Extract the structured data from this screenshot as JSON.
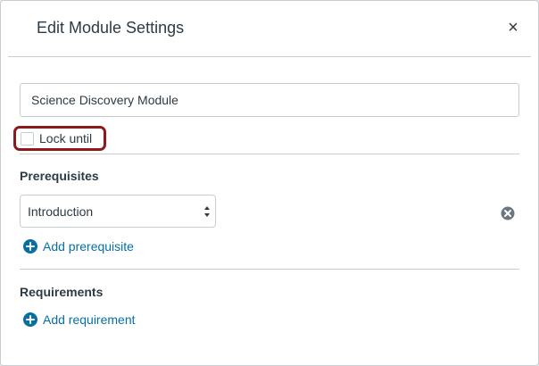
{
  "dialog": {
    "title": "Edit Module Settings",
    "close_symbol": "×"
  },
  "module": {
    "name_value": "Science Discovery Module",
    "lock_until_label": "Lock until",
    "lock_until_checked": false
  },
  "prerequisites": {
    "heading": "Prerequisites",
    "selected": "Introduction",
    "add_label": "Add prerequisite"
  },
  "requirements": {
    "heading": "Requirements",
    "add_label": "Add requirement"
  },
  "colors": {
    "text": "#2d3b45",
    "link": "#0770a3",
    "border": "#c7cdd1",
    "highlight": "#8b1a1a"
  },
  "icons": {
    "close": "close-icon",
    "remove": "remove-circle-icon",
    "add": "plus-circle-icon",
    "select": "select-arrows-icon"
  }
}
